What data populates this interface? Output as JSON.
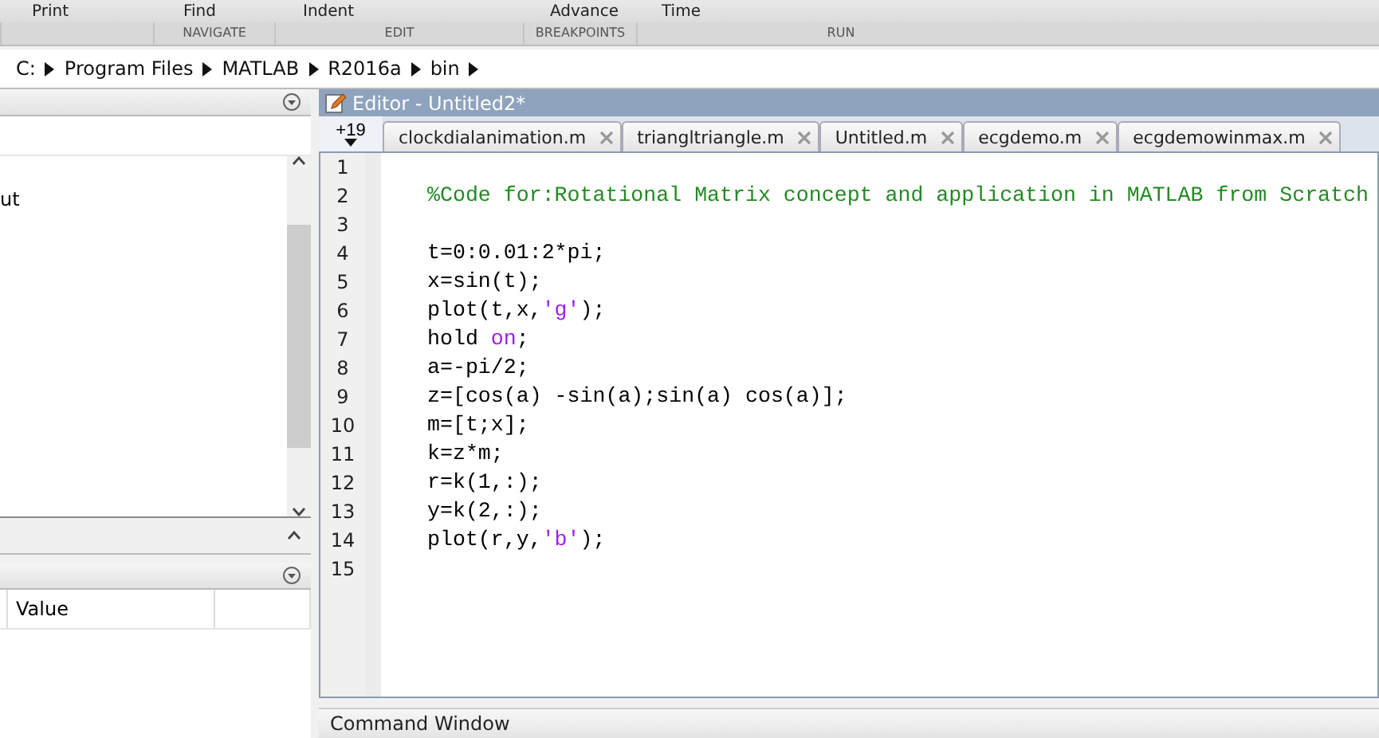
{
  "toolbar": {
    "buttons": [
      "Print",
      "Find",
      "Indent",
      "Advance",
      "Time"
    ],
    "sections": [
      "NAVIGATE",
      "EDIT",
      "BREAKPOINTS",
      "RUN"
    ]
  },
  "address_bar": {
    "path": [
      "C:",
      "Program Files",
      "MATLAB",
      "R2016a",
      "bin"
    ]
  },
  "current_folder": {
    "visible_text": "ut"
  },
  "workspace": {
    "columns": [
      "Value"
    ]
  },
  "editor": {
    "title": "Editor - Untitled2*",
    "hidden_tab_count": "+19",
    "tabs": [
      {
        "label": "clockdialanimation.m",
        "selected": false
      },
      {
        "label": "triangltriangle.m",
        "selected": false
      },
      {
        "label": "Untitled.m",
        "selected": false
      },
      {
        "label": "ecgdemo.m",
        "selected": false
      },
      {
        "label": "ecgdemowinmax.m",
        "selected": false
      }
    ],
    "lines": [
      {
        "number": "1"
      },
      {
        "number": "2",
        "segments": [
          {
            "text": "%Code for:Rotational Matrix concept and application in MATLAB from Scratch",
            "kind": "comment"
          }
        ]
      },
      {
        "number": "3"
      },
      {
        "number": "4",
        "segments": [
          {
            "text": "t=0:0.01:2*pi;",
            "kind": "plain"
          }
        ]
      },
      {
        "number": "5",
        "segments": [
          {
            "text": "x=sin(t);",
            "kind": "plain"
          }
        ]
      },
      {
        "number": "6",
        "segments": [
          {
            "text": "plot(t,x,",
            "kind": "plain"
          },
          {
            "text": "'g'",
            "kind": "string"
          },
          {
            "text": ");",
            "kind": "plain"
          }
        ]
      },
      {
        "number": "7",
        "segments": [
          {
            "text": "hold ",
            "kind": "plain"
          },
          {
            "text": "on",
            "kind": "string"
          },
          {
            "text": ";",
            "kind": "plain"
          }
        ]
      },
      {
        "number": "8",
        "segments": [
          {
            "text": "a=-pi/2;",
            "kind": "plain"
          }
        ]
      },
      {
        "number": "9",
        "segments": [
          {
            "text": "z=[cos(a) -sin(a);sin(a) cos(a)];",
            "kind": "plain"
          }
        ]
      },
      {
        "number": "10",
        "segments": [
          {
            "text": "m=[t;x];",
            "kind": "plain"
          }
        ]
      },
      {
        "number": "11",
        "segments": [
          {
            "text": "k=z*m;",
            "kind": "plain"
          }
        ]
      },
      {
        "number": "12",
        "segments": [
          {
            "text": "r=k(1,:);",
            "kind": "plain"
          }
        ]
      },
      {
        "number": "13",
        "segments": [
          {
            "text": "y=k(2,:);",
            "kind": "plain"
          }
        ]
      },
      {
        "number": "14",
        "segments": [
          {
            "text": "plot(r,y,",
            "kind": "plain"
          },
          {
            "text": "'b'",
            "kind": "string"
          },
          {
            "text": ");",
            "kind": "plain"
          }
        ]
      },
      {
        "number": "15"
      }
    ]
  },
  "command_window": {
    "title": "Command Window"
  }
}
